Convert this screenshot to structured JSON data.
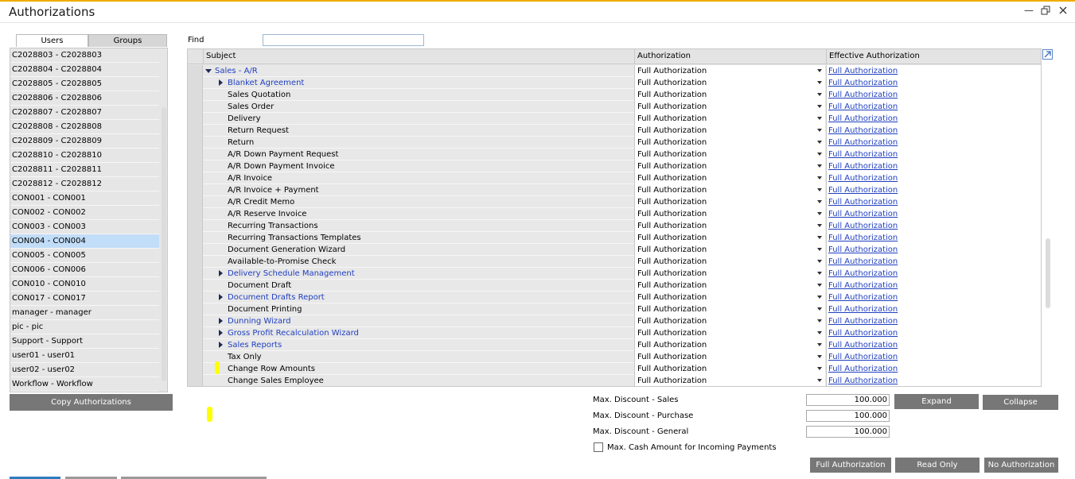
{
  "window": {
    "title": "Authorizations"
  },
  "tabs": {
    "users": "Users",
    "groups": "Groups"
  },
  "users": [
    "C2028803 - C2028803",
    "C2028804 - C2028804",
    "C2028805 - C2028805",
    "C2028806 - C2028806",
    "C2028807 - C2028807",
    "C2028808 - C2028808",
    "C2028809 - C2028809",
    "C2028810 - C2028810",
    "C2028811 - C2028811",
    "C2028812 - C2028812",
    "CON001 - CON001",
    "CON002 - CON002",
    "CON003 - CON003",
    "CON004 - CON004",
    "CON005 - CON005",
    "CON006 - CON006",
    "CON010 - CON010",
    "CON017 - CON017",
    "manager - manager",
    "pic - pic",
    "Support - Support",
    "user01 - user01",
    "user02 - user02",
    "Workflow - Workflow"
  ],
  "selected_user": "CON004 - CON004",
  "buttons": {
    "copy_authorizations": "Copy Authorizations",
    "expand": "Expand",
    "collapse": "Collapse",
    "full_authorization": "Full Authorization",
    "read_only": "Read Only",
    "no_authorization": "No Authorization"
  },
  "find": {
    "label": "Find",
    "value": ""
  },
  "grid": {
    "headers": {
      "subject": "Subject",
      "authorization": "Authorization",
      "effective": "Effective Authorization"
    },
    "rows": [
      {
        "subject": "Sales - A/R",
        "kind": "expanded",
        "level": 0,
        "auth": "Full Authorization",
        "effective": "Full Authorization"
      },
      {
        "subject": "Blanket Agreement",
        "kind": "collapsed",
        "level": 1,
        "auth": "Full Authorization",
        "effective": "Full Authorization"
      },
      {
        "subject": "Sales Quotation",
        "kind": "leaf",
        "level": 1,
        "auth": "Full Authorization",
        "effective": "Full Authorization"
      },
      {
        "subject": "Sales Order",
        "kind": "leaf",
        "level": 1,
        "auth": "Full Authorization",
        "effective": "Full Authorization"
      },
      {
        "subject": "Delivery",
        "kind": "leaf",
        "level": 1,
        "auth": "Full Authorization",
        "effective": "Full Authorization"
      },
      {
        "subject": "Return Request",
        "kind": "leaf",
        "level": 1,
        "auth": "Full Authorization",
        "effective": "Full Authorization"
      },
      {
        "subject": "Return",
        "kind": "leaf",
        "level": 1,
        "auth": "Full Authorization",
        "effective": "Full Authorization"
      },
      {
        "subject": "A/R Down Payment Request",
        "kind": "leaf",
        "level": 1,
        "auth": "Full Authorization",
        "effective": "Full Authorization"
      },
      {
        "subject": "A/R Down Payment Invoice",
        "kind": "leaf",
        "level": 1,
        "auth": "Full Authorization",
        "effective": "Full Authorization"
      },
      {
        "subject": "A/R Invoice",
        "kind": "leaf",
        "level": 1,
        "auth": "Full Authorization",
        "effective": "Full Authorization"
      },
      {
        "subject": "A/R Invoice + Payment",
        "kind": "leaf",
        "level": 1,
        "auth": "Full Authorization",
        "effective": "Full Authorization"
      },
      {
        "subject": "A/R Credit Memo",
        "kind": "leaf",
        "level": 1,
        "auth": "Full Authorization",
        "effective": "Full Authorization"
      },
      {
        "subject": "A/R Reserve Invoice",
        "kind": "leaf",
        "level": 1,
        "auth": "Full Authorization",
        "effective": "Full Authorization"
      },
      {
        "subject": "Recurring Transactions",
        "kind": "leaf",
        "level": 1,
        "auth": "Full Authorization",
        "effective": "Full Authorization"
      },
      {
        "subject": "Recurring Transactions Templates",
        "kind": "leaf",
        "level": 1,
        "auth": "Full Authorization",
        "effective": "Full Authorization"
      },
      {
        "subject": "Document Generation Wizard",
        "kind": "leaf",
        "level": 1,
        "auth": "Full Authorization",
        "effective": "Full Authorization"
      },
      {
        "subject": "Available-to-Promise Check",
        "kind": "leaf",
        "level": 1,
        "auth": "Full Authorization",
        "effective": "Full Authorization"
      },
      {
        "subject": "Delivery Schedule Management",
        "kind": "collapsed",
        "level": 1,
        "auth": "Full Authorization",
        "effective": "Full Authorization"
      },
      {
        "subject": "Document Draft",
        "kind": "leaf",
        "level": 1,
        "auth": "Full Authorization",
        "effective": "Full Authorization"
      },
      {
        "subject": "Document Drafts Report",
        "kind": "collapsed",
        "level": 1,
        "auth": "Full Authorization",
        "effective": "Full Authorization"
      },
      {
        "subject": "Document Printing",
        "kind": "leaf",
        "level": 1,
        "auth": "Full Authorization",
        "effective": "Full Authorization"
      },
      {
        "subject": "Dunning Wizard",
        "kind": "collapsed",
        "level": 1,
        "auth": "Full Authorization",
        "effective": "Full Authorization"
      },
      {
        "subject": "Gross Profit Recalculation Wizard",
        "kind": "collapsed",
        "level": 1,
        "auth": "Full Authorization",
        "effective": "Full Authorization"
      },
      {
        "subject": "Sales Reports",
        "kind": "collapsed",
        "level": 1,
        "auth": "Full Authorization",
        "effective": "Full Authorization"
      },
      {
        "subject": "Tax Only",
        "kind": "leaf",
        "level": 1,
        "auth": "Full Authorization",
        "effective": "Full Authorization"
      },
      {
        "subject": "Change Row Amounts",
        "kind": "leaf",
        "level": 1,
        "auth": "Full Authorization",
        "effective": "Full Authorization"
      },
      {
        "subject": "Change Sales Employee",
        "kind": "leaf",
        "level": 1,
        "auth": "Full Authorization",
        "effective": "Full Authorization"
      }
    ]
  },
  "fields": {
    "max_discount_sales": {
      "label": "Max. Discount - Sales",
      "value": "100.000"
    },
    "max_discount_purchase": {
      "label": "Max. Discount - Purchase",
      "value": "100.000"
    },
    "max_discount_general": {
      "label": "Max. Discount - General",
      "value": "100.000"
    },
    "max_cash": {
      "label": "Max. Cash Amount for Incoming Payments",
      "checked": false
    }
  },
  "colors": {
    "accent_bar": "#f0ab00",
    "button_bg": "#777777",
    "selected_row": "#c2ddf8",
    "link": "#1f3fbf",
    "highlight": "#ffff00"
  }
}
